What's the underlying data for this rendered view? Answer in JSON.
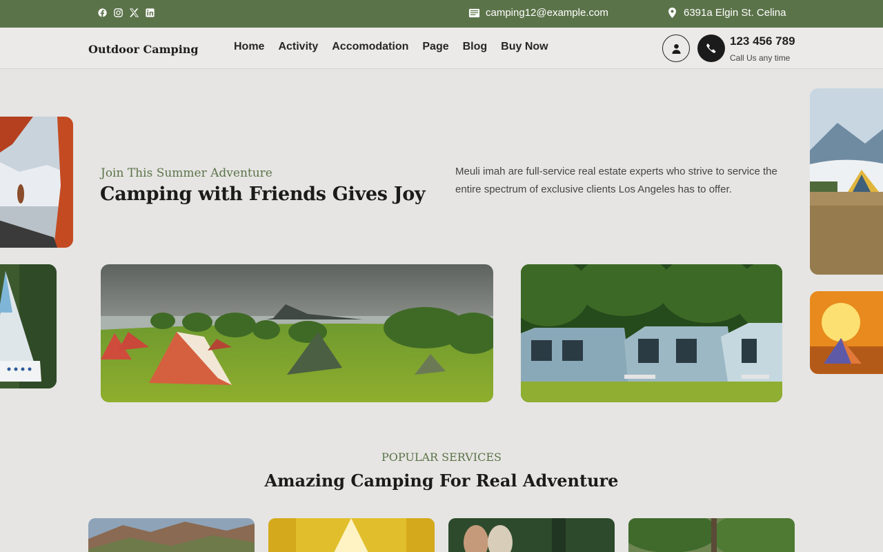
{
  "topbar": {
    "social": [
      "facebook-icon",
      "instagram-icon",
      "x-icon",
      "linkedin-icon"
    ],
    "email": "camping12@example.com",
    "address": "6391a Elgin St. Celina"
  },
  "header": {
    "logo": "Outdoor Camping",
    "nav": [
      "Home",
      "Activity",
      "Accomodation",
      "Page",
      "Blog",
      "Buy Now"
    ],
    "phone": "123 456 789",
    "phone_caption": "Call Us any time"
  },
  "hero": {
    "eyebrow": "Join This Summer Adventure",
    "title": "Camping with Friends Gives Joy",
    "description": "Meuli imah are full-service real estate experts who strive to service the entire spectrum of exclusive clients Los Angeles has to offer."
  },
  "services": {
    "eyebrow": "POPULAR SERVICES",
    "title": "Amazing Camping For Real Adventure"
  },
  "colors": {
    "brand_green": "#5b7349",
    "background": "#e6e5e3",
    "dark": "#1b1b1b"
  }
}
